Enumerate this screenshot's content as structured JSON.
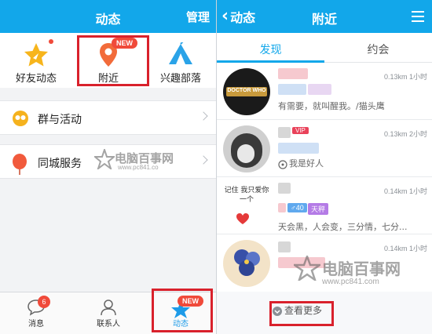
{
  "left": {
    "header": {
      "title": "动态",
      "manage": "管理"
    },
    "features": [
      {
        "label": "好友动态",
        "icon": "friend-feed-star-icon"
      },
      {
        "label": "附近",
        "icon": "location-pin-icon",
        "badge": "NEW"
      },
      {
        "label": "兴趣部落",
        "icon": "tribe-tent-icon"
      }
    ],
    "rows": [
      {
        "label": "群与活动",
        "icon": "group-activity-icon"
      },
      {
        "label": "同城服务",
        "icon": "local-service-balloon-icon"
      }
    ],
    "watermark": {
      "title": "电脑百事网",
      "url": "www.pc841.co"
    },
    "tabs": [
      {
        "label": "消息",
        "icon": "chat-bubble-icon",
        "count": "6"
      },
      {
        "label": "联系人",
        "icon": "contact-person-icon"
      },
      {
        "label": "动态",
        "icon": "star-icon",
        "badge": "NEW",
        "active": true
      }
    ]
  },
  "right": {
    "header": {
      "back": "动态",
      "title": "附近"
    },
    "tabs": [
      {
        "label": "发现",
        "active": true
      },
      {
        "label": "约会"
      }
    ],
    "people": [
      {
        "distance": "0.13km 1小时",
        "signature": "有需要，就叫醒我。/猫头鹰",
        "avatar_text": "DOCTOR WHO"
      },
      {
        "distance": "0.13km 2小时",
        "signature": "我是好人",
        "vip": "VIP"
      },
      {
        "distance": "0.14km 1小时",
        "signature": "天会黑，人会变，三分情，七分...",
        "age": "♂40",
        "zodiac": "天秤",
        "avatar_text": "记住 我只爱你一个"
      },
      {
        "distance": "0.14km 1小时",
        "signature": ""
      }
    ],
    "watermark": {
      "title": "电脑百事网",
      "url": "www.pc841.com"
    },
    "load_more": "查看更多"
  },
  "colors": {
    "brand": "#12a7ea",
    "highlight": "#d9212c",
    "badge": "#f04a3a"
  }
}
